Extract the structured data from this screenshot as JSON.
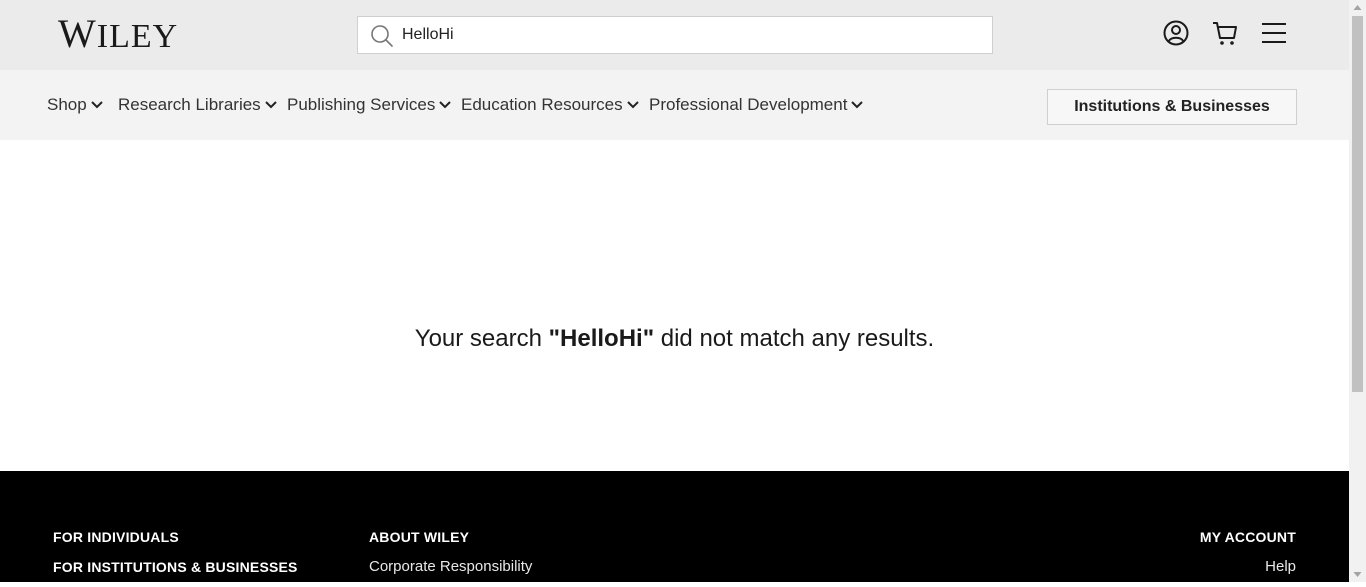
{
  "header": {
    "logo_text": "WILEY",
    "search": {
      "value": "HelloHi",
      "placeholder": ""
    },
    "icons": [
      "account-icon",
      "cart-icon",
      "menu-icon"
    ]
  },
  "nav": {
    "items": [
      {
        "label": "Shop"
      },
      {
        "label": "Research Libraries"
      },
      {
        "label": "Publishing Services"
      },
      {
        "label": "Education Resources"
      },
      {
        "label": "Professional Development"
      }
    ],
    "cta_label": "Institutions & Businesses"
  },
  "results": {
    "prefix": "Your search ",
    "query": "\"HelloHi\"",
    "suffix": " did not match any results."
  },
  "footer": {
    "col1": {
      "heading1": "FOR INDIVIDUALS",
      "heading2": "FOR INSTITUTIONS & BUSINESSES"
    },
    "col2": {
      "heading": "ABOUT WILEY",
      "link1": "Corporate Responsibility"
    },
    "col3": {
      "heading": "MY ACCOUNT",
      "link1": "Help"
    }
  },
  "colors": {
    "topbar": "#ebebeb",
    "navbar": "#f3f3f3",
    "footer": "#000000"
  }
}
